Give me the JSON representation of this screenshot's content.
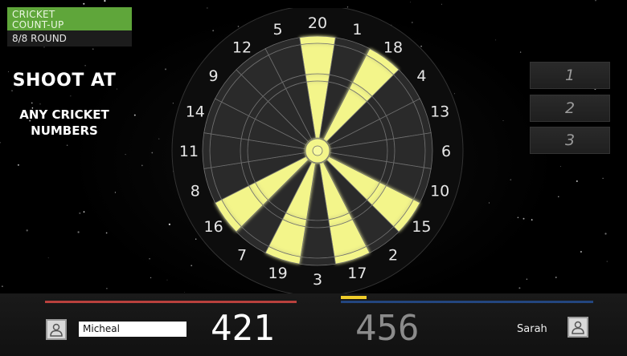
{
  "mode": {
    "title_line1": "CRICKET",
    "title_line2": "COUNT-UP",
    "round": "8/8 ROUND"
  },
  "instruction": {
    "heading": "SHOOT AT",
    "line1": "ANY CRICKET",
    "line2": "NUMBERS"
  },
  "throws": [
    "1",
    "2",
    "3"
  ],
  "board": {
    "numbers": [
      "20",
      "1",
      "18",
      "4",
      "13",
      "6",
      "10",
      "15",
      "2",
      "17",
      "3",
      "19",
      "7",
      "16",
      "8",
      "11",
      "14",
      "9",
      "12",
      "5"
    ],
    "highlighted_numbers": [
      "20",
      "18",
      "15",
      "17",
      "19",
      "16"
    ],
    "highlighted_bull": true,
    "highlight_color": "#f3f58a",
    "segment_color": "#2a2a2a",
    "wire_color": "#6f6f6f"
  },
  "players": [
    {
      "name": "Micheal",
      "score": "421",
      "color": "#b8413d",
      "active": true,
      "icon": "user-icon"
    },
    {
      "name": "Sarah",
      "score": "456",
      "color": "#23467f",
      "active": false,
      "icon": "user-icon"
    }
  ],
  "colors": {
    "mode_green": "#5fa63a",
    "turn_indicator": "#f0cd2a"
  }
}
